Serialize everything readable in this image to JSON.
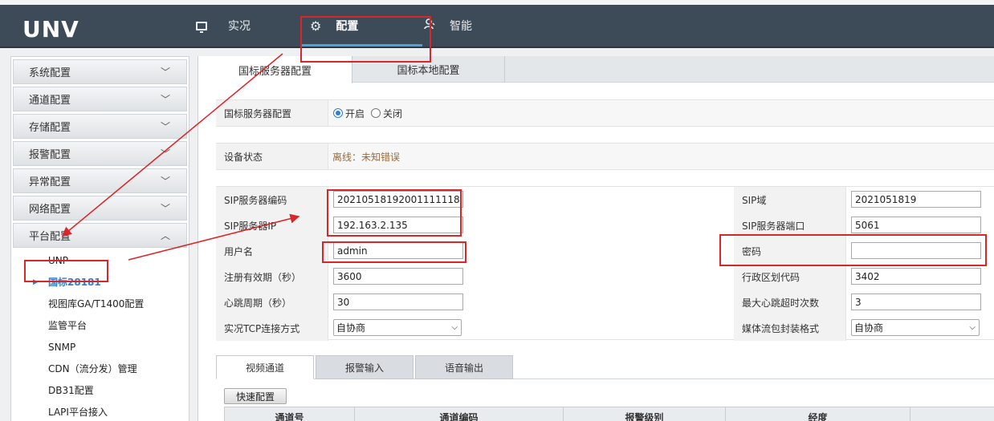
{
  "header": {
    "logo": "UNV",
    "nav": [
      {
        "label": "实况",
        "icon": "monitor-icon"
      },
      {
        "label": "配置",
        "icon": "gear-icon"
      },
      {
        "label": "智能",
        "icon": "person-icon"
      }
    ]
  },
  "sidebar": {
    "categories": [
      {
        "label": "系统配置",
        "chevron": "⌄"
      },
      {
        "label": "通道配置",
        "chevron": "⌄"
      },
      {
        "label": "存储配置",
        "chevron": "⌄"
      },
      {
        "label": "报警配置",
        "chevron": "⌄"
      },
      {
        "label": "异常配置",
        "chevron": "⌄"
      },
      {
        "label": "网络配置",
        "chevron": "⌄"
      },
      {
        "label": "平台配置",
        "chevron": "⌃"
      }
    ],
    "sub_items": [
      {
        "label": "UNP"
      },
      {
        "label": "国标28181"
      },
      {
        "label": "视图库GA/T1400配置"
      },
      {
        "label": "监管平台"
      },
      {
        "label": "SNMP"
      },
      {
        "label": "CDN（流分发）管理"
      },
      {
        "label": "DB31配置"
      },
      {
        "label": "LAPI平台接入"
      }
    ]
  },
  "main": {
    "tabs": [
      {
        "label": "国标服务器配置"
      },
      {
        "label": "国标本地配置"
      }
    ],
    "server_config": {
      "label": "国标服务器配置",
      "option_on": "开启",
      "option_off": "关闭",
      "selected": "开启"
    },
    "device_status": {
      "label": "设备状态",
      "value": "离线：未知错误"
    },
    "fields": {
      "sip_server_id_label": "SIP服务器编码",
      "sip_server_id": "20210518192001111118",
      "sip_domain_label": "SIP域",
      "sip_domain": "2021051819",
      "sip_server_ip_label": "SIP服务器IP",
      "sip_server_ip": "192.163.2.135",
      "sip_server_port_label": "SIP服务器端口",
      "sip_server_port": "5061",
      "username_label": "用户名",
      "username": "admin",
      "password_label": "密码",
      "password": "",
      "reg_expiry_label": "注册有效期（秒）",
      "reg_expiry": "3600",
      "region_code_label": "行政区划代码",
      "region_code": "3402",
      "heartbeat_label": "心跳周期（秒）",
      "heartbeat": "30",
      "max_heartbeat_timeout_label": "最大心跳超时次数",
      "max_heartbeat_timeout": "3",
      "tcp_mode_label": "实况TCP连接方式",
      "tcp_mode": "自协商",
      "stream_format_label": "媒体流包封装格式",
      "stream_format": "自协商"
    },
    "sub_tabs": [
      {
        "label": "视频通道"
      },
      {
        "label": "报警输入"
      },
      {
        "label": "语音输出"
      }
    ],
    "quick_config": "快速配置",
    "table_headers": [
      "通道号",
      "通道编码",
      "报警级别",
      "经度"
    ]
  }
}
